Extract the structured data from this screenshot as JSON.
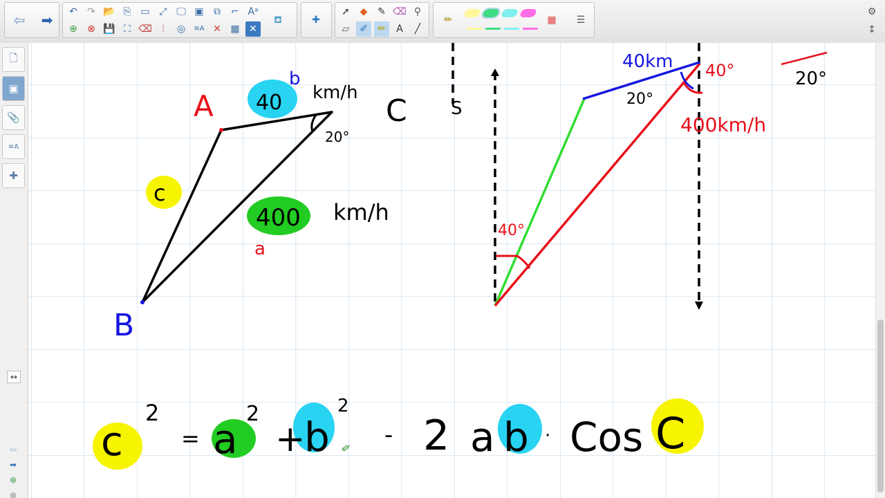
{
  "toolbar": {
    "nav": [
      "back-arrow",
      "forward-arrow"
    ],
    "settings_icon": "gear-icon",
    "expand_icon": "updown-arrow-icon"
  },
  "highlighter_colors": [
    "#fff79a",
    "#3ddc84",
    "#7ff0f0",
    "#ff6ee6"
  ],
  "annotations": {
    "label_A": "A",
    "label_B": "B",
    "label_b": "b",
    "label_a": "a",
    "label_c_circle": "c",
    "speed_top": "40",
    "unit_top": "km/h",
    "speed_main": "400",
    "unit_main": "km/h",
    "angle_top": "20°",
    "letter_C": "C",
    "letter_S": "S",
    "right_top_speed": "40km",
    "right_angle_40": "40°",
    "right_angle_20": "20°",
    "right_speed_red": "400km/h",
    "right_angle_green": "40°",
    "corner_angle": "20°"
  },
  "formula": {
    "c": "c",
    "exp_c": "2",
    "eq": "=",
    "a": "a",
    "exp_a": "2",
    "plus": "+",
    "b": "b",
    "exp_b": "2",
    "minus": "-",
    "two": "2",
    "ab_a": "a",
    "ab_b": "b",
    "dot": "·",
    "cos": "Cos",
    "C": "C"
  },
  "sidebar": {
    "tabs": [
      "page-sorter",
      "gallery",
      "attachments",
      "properties",
      "add-ons"
    ]
  },
  "colors": {
    "red": "#e8101a",
    "blue": "#1515e0",
    "green": "#22cc22",
    "black": "#000000",
    "yellow": "#f7f400",
    "cyan": "#29d3f2",
    "grid": "#c5d9ee"
  }
}
